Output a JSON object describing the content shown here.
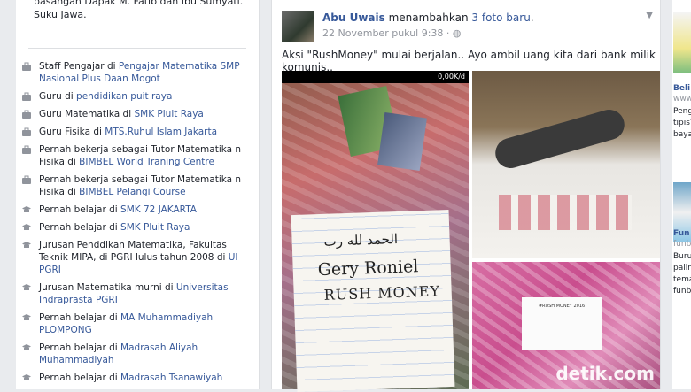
{
  "intro": {
    "top_text": "pasangan Dapak M. Fatib dan Ibu Sumyati. Suku Jawa.",
    "items": [
      {
        "prefix": "Staff Pengajar di ",
        "link": "Pengajar Matematika SMP Nasional Plus Daan Mogot",
        "icon": "briefcase-icon"
      },
      {
        "prefix": "Guru di ",
        "link": "pendidikan puit raya",
        "icon": "briefcase-icon"
      },
      {
        "prefix": "Guru Matematika di ",
        "link": "SMK Pluit Raya",
        "icon": "briefcase-icon"
      },
      {
        "prefix": "Guru Fisika di ",
        "link": "MTS.Ruhul Islam Jakarta",
        "icon": "briefcase-icon"
      },
      {
        "prefix": "Pernah bekerja sebagai Tutor Matematika n Fisika di ",
        "link": "BIMBEL World Traning Centre",
        "icon": "briefcase-icon"
      },
      {
        "prefix": "Pernah bekerja sebagai Tutor Matematika n Fisika di ",
        "link": "BIMBEL Pelangi Course",
        "icon": "briefcase-icon"
      },
      {
        "prefix": "Pernah belajar di ",
        "link": "SMK 72 JAKARTA",
        "icon": "graduation-cap-icon"
      },
      {
        "prefix": "Pernah belajar di ",
        "link": "SMK Pluit Raya",
        "icon": "graduation-cap-icon"
      },
      {
        "prefix": "Jurusan Penddikan Matematika, Fakultas Teknik MIPA, di PGRI lulus tahun 2008 di ",
        "link": "UI PGRI",
        "icon": "graduation-cap-icon"
      },
      {
        "prefix": "Jurusan Matematika murni di ",
        "link": "Universitas Indraprasta PGRI",
        "icon": "graduation-cap-icon"
      },
      {
        "prefix": "Pernah belajar di ",
        "link": "MA Muhammadiyah PLOMPONG",
        "icon": "graduation-cap-icon"
      },
      {
        "prefix": "Pernah belajar di ",
        "link": "Madrasah Aliyah Muhammadiyah",
        "icon": "graduation-cap-icon"
      },
      {
        "prefix": "Pernah belajar di ",
        "link": "Madrasah Tsanawiyah",
        "icon": "graduation-cap-icon"
      }
    ]
  },
  "post": {
    "author": "Abu Uwais",
    "action_prefix": " menambahkan ",
    "photo_count": "3 foto baru",
    "action_suffix": ".",
    "timestamp": "22 November pukul 9:38 ·",
    "text": "Aksi \"RushMoney\" mulai berjalan.. Ayo ambil uang kita dari bank milik komunis..",
    "photo1": {
      "status_bar": "0,00K/d",
      "note_arabic": "الحمد لله رب",
      "note_line1": "Gery Roniel",
      "note_line2": "RUSH MONEY"
    },
    "photo3_paper": "#RUSH MONEY 2016",
    "watermark": "detik.com"
  },
  "right": {
    "text_a": "Beli",
    "text_b": "www",
    "text_c": "Peng",
    "text_d": "tipis?",
    "text_e": "baya",
    "text_f": "Fun",
    "text_g": "funb",
    "text_h": "Buru",
    "text_i": "paling",
    "text_j": "tema",
    "text_k": "funb"
  }
}
